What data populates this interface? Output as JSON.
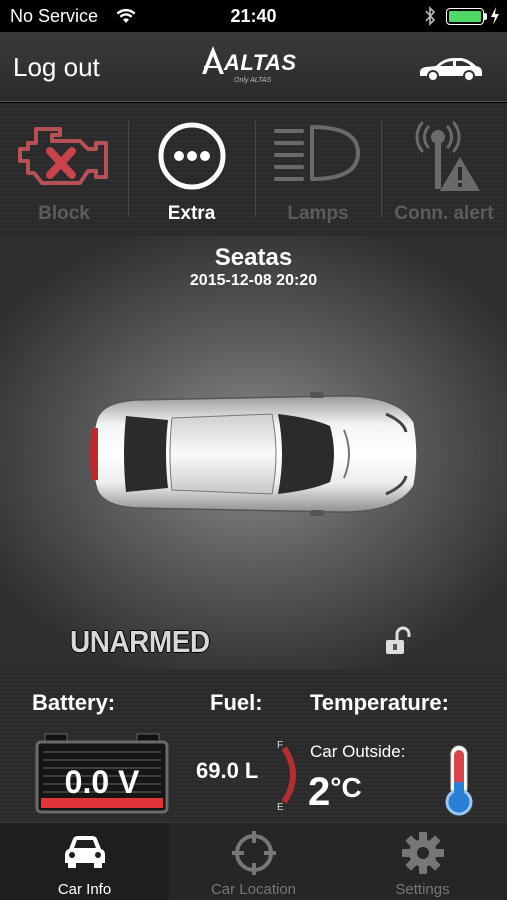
{
  "status_bar": {
    "carrier": "No Service",
    "time": "21:40",
    "battery_level": 1.0
  },
  "header": {
    "logout_label": "Log out",
    "brand": "ALTAS",
    "tagline": "Only ALTAS"
  },
  "actions": [
    {
      "label": "Block",
      "icon": "engine-warning-icon",
      "enabled": false
    },
    {
      "label": "Extra",
      "icon": "more-icon",
      "enabled": true
    },
    {
      "label": "Lamps",
      "icon": "headlamp-icon",
      "enabled": false
    },
    {
      "label": "Conn. alert",
      "icon": "antenna-alert-icon",
      "enabled": false
    }
  ],
  "vehicle": {
    "name": "Seatas",
    "datetime": "2015-12-08 20:20",
    "arm_status": "UNARMED",
    "lock_state": "unlocked"
  },
  "info": {
    "battery_title": "Battery:",
    "battery_value": "0.0 V",
    "fuel_title": "Fuel:",
    "fuel_value": "69.0 L",
    "fuel_gauge_full": "F",
    "fuel_gauge_empty": "E",
    "temp_title": "Temperature:",
    "temp_label": "Car Outside:",
    "temp_value": "2",
    "temp_unit": "°C"
  },
  "tabs": [
    {
      "label": "Car Info",
      "icon": "car-icon",
      "active": true
    },
    {
      "label": "Car Location",
      "icon": "crosshair-icon",
      "active": false
    },
    {
      "label": "Settings",
      "icon": "gear-icon",
      "active": false
    }
  ],
  "colors": {
    "accent_red": "#e0343a",
    "battery_green": "#4cd964",
    "thermo_blue": "#2a7fd6"
  }
}
